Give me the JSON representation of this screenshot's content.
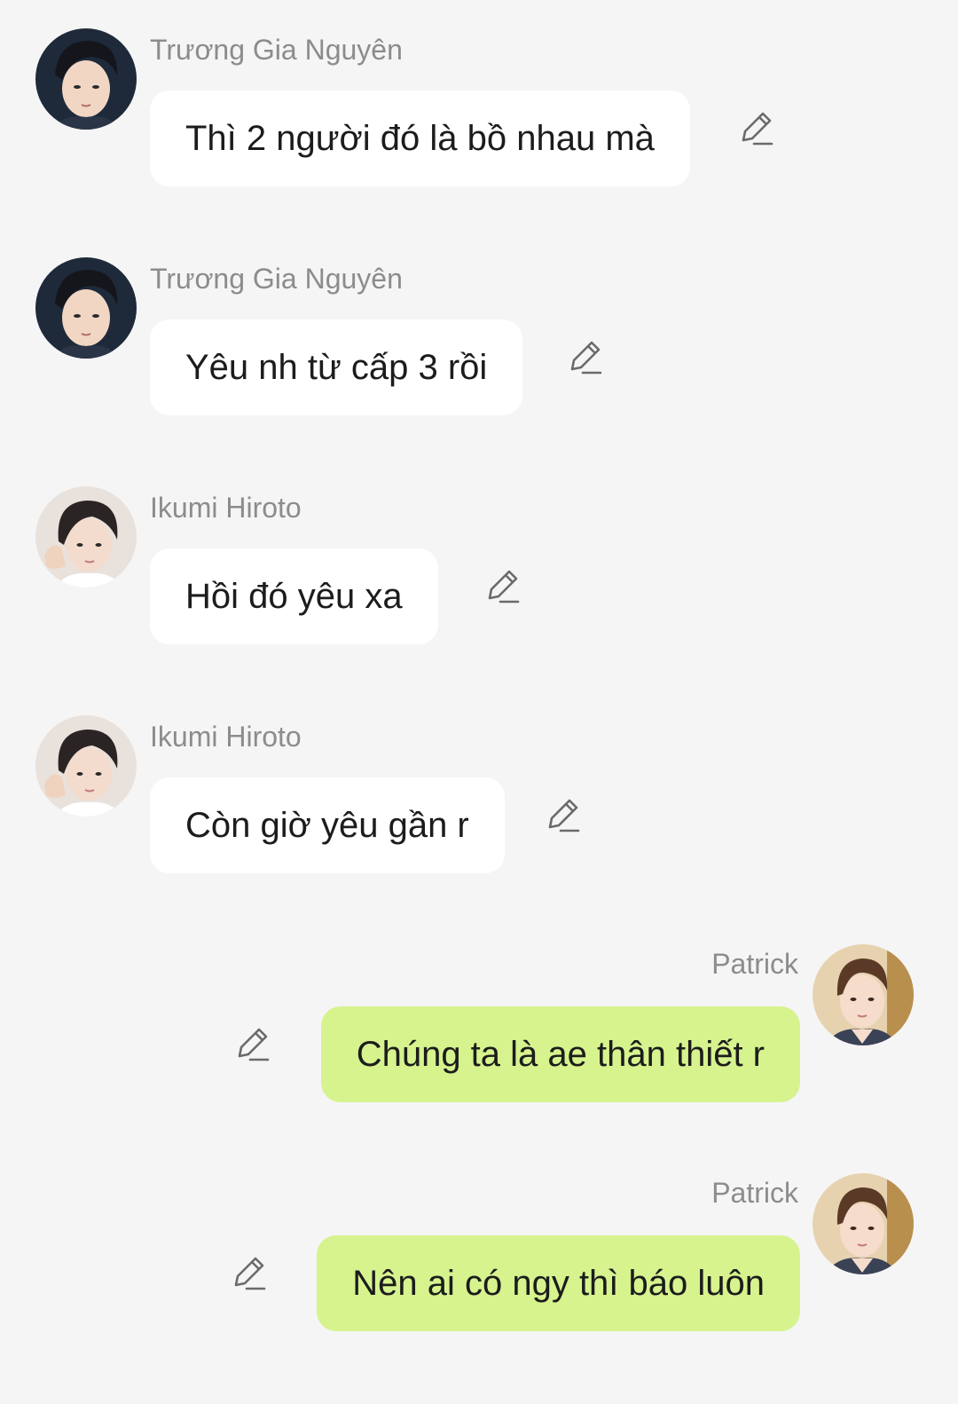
{
  "messages": [
    {
      "sender": "Trương Gia Nguyên",
      "text": "Thì 2 người đó là bồ nhau mà",
      "direction": "in",
      "avatar": "avatar-truong-gia-nguyen"
    },
    {
      "sender": "Trương Gia Nguyên",
      "text": "Yêu nh từ cấp 3 rồi",
      "direction": "in",
      "avatar": "avatar-truong-gia-nguyen"
    },
    {
      "sender": "Ikumi Hiroto",
      "text": "Hồi đó yêu xa",
      "direction": "in",
      "avatar": "avatar-ikumi-hiroto"
    },
    {
      "sender": "Ikumi Hiroto",
      "text": "Còn giờ yêu gần r",
      "direction": "in",
      "avatar": "avatar-ikumi-hiroto"
    },
    {
      "sender": "Patrick",
      "text": "Chúng ta là ae thân thiết r",
      "direction": "out",
      "avatar": "avatar-patrick"
    },
    {
      "sender": "Patrick",
      "text": "Nên ai có ngy thì báo luôn",
      "direction": "out",
      "avatar": "avatar-patrick"
    }
  ],
  "colors": {
    "background": "#f5f5f5",
    "incoming_bubble": "#ffffff",
    "outgoing_bubble": "#d6f38e",
    "sender_name": "#8c8c8c",
    "message_text": "#1c1c1c"
  },
  "icons": {
    "edit": "pencil-edit-icon"
  }
}
